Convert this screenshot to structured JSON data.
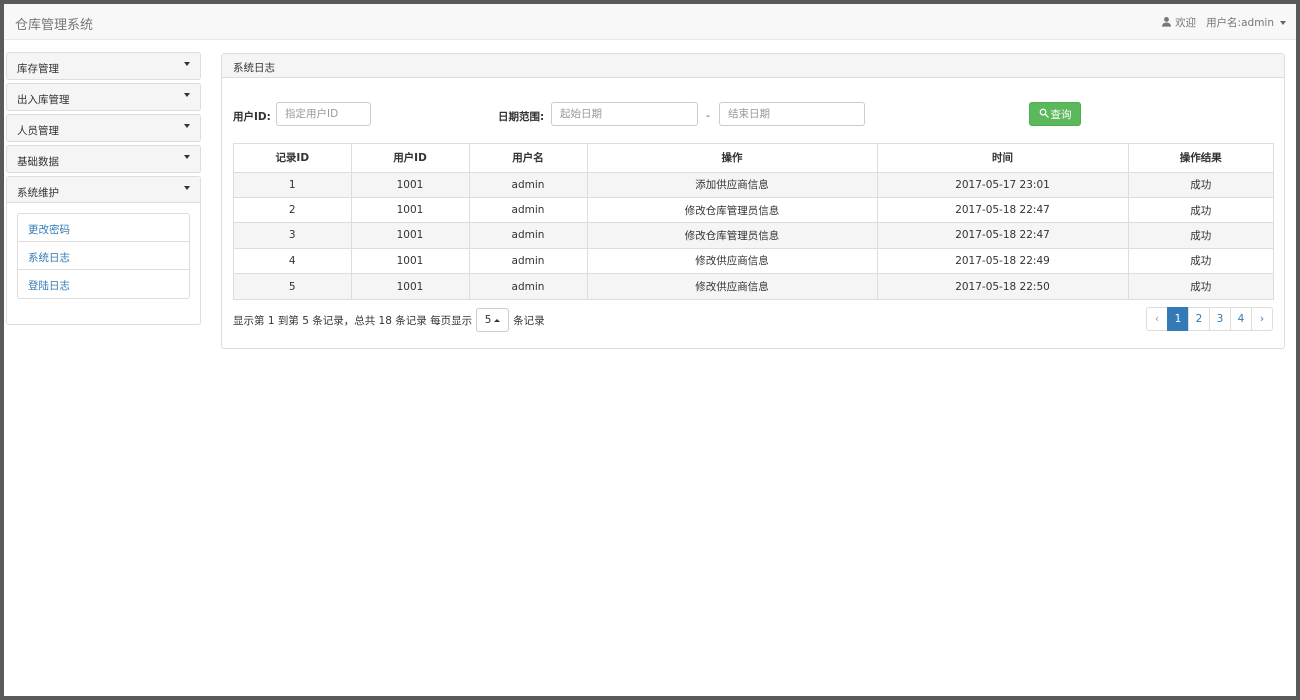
{
  "app": {
    "title": "仓库管理系统"
  },
  "user": {
    "welcome": "欢迎",
    "name_label": "用户名:admin"
  },
  "sidebar": {
    "groups": [
      {
        "label": "库存管理"
      },
      {
        "label": "出入库管理"
      },
      {
        "label": "人员管理"
      },
      {
        "label": "基础数据"
      },
      {
        "label": "系统维护",
        "items": [
          "更改密码",
          "系统日志",
          "登陆日志"
        ]
      }
    ]
  },
  "main": {
    "title": "系统日志",
    "search": {
      "user_id_label": "用户ID:",
      "user_id_placeholder": "指定用户ID",
      "date_label": "日期范围:",
      "start_placeholder": "起始日期",
      "dash": "-",
      "end_placeholder": "结束日期",
      "query_label": "查询"
    },
    "table": {
      "columns": [
        "记录ID",
        "用户ID",
        "用户名",
        "操作",
        "时间",
        "操作结果"
      ],
      "rows": [
        [
          "1",
          "1001",
          "admin",
          "添加供应商信息",
          "2017-05-17 23:01",
          "成功"
        ],
        [
          "2",
          "1001",
          "admin",
          "修改仓库管理员信息",
          "2017-05-18 22:47",
          "成功"
        ],
        [
          "3",
          "1001",
          "admin",
          "修改仓库管理员信息",
          "2017-05-18 22:47",
          "成功"
        ],
        [
          "4",
          "1001",
          "admin",
          "修改供应商信息",
          "2017-05-18 22:49",
          "成功"
        ],
        [
          "5",
          "1001",
          "admin",
          "修改供应商信息",
          "2017-05-18 22:50",
          "成功"
        ]
      ]
    },
    "pager": {
      "info": "显示第 1 到第 5 条记录，总共 18 条记录 每页显示",
      "page_size": "5",
      "suffix": "条记录",
      "prev": "‹",
      "pages": [
        "1",
        "2",
        "3",
        "4"
      ],
      "next": "›",
      "active_page": "1"
    }
  },
  "colors": {
    "accent": "#337ab7",
    "success": "#5cb85c"
  }
}
